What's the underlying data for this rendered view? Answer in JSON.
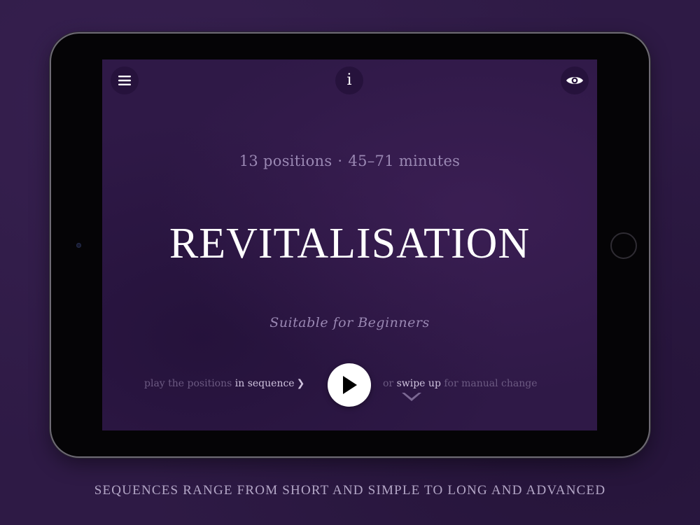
{
  "screen": {
    "toolbar": {
      "menu_icon": "hamburger-icon",
      "info_label": "i",
      "eye_icon": "eye-icon"
    },
    "meta": {
      "positions": "13 positions",
      "separator": "·",
      "duration": "45–71 minutes"
    },
    "title": "REVITALISATION",
    "level": "Suitable for Beginners",
    "controls": {
      "left_hint_prefix": "play the positions",
      "left_hint_emphasis": "in sequence",
      "left_hint_chevron": "❯",
      "play_icon": "play-icon",
      "right_hint_prefix": "or",
      "right_hint_emphasis": "swipe up",
      "right_hint_suffix": "for manual change",
      "swipe_icon": "chevron-down-icon"
    }
  },
  "caption": "SEQUENCES RANGE FROM SHORT AND SIMPLE TO LONG AND ADVANCED",
  "colors": {
    "background": "#2e1a45",
    "screen": "#2f1947",
    "title": "#ffffff",
    "muted_text": "#9a88b3",
    "play_button": "#ffffff"
  }
}
